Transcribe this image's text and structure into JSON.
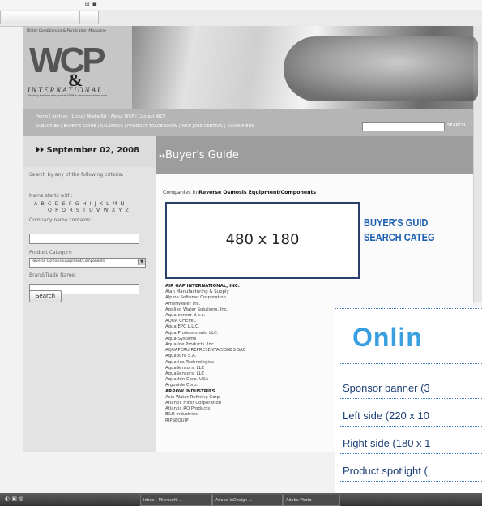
{
  "browser": {
    "top_icons": "⊞ ▣"
  },
  "site": {
    "magazine_tagline": "Water Conditioning & Purification Magazine",
    "logo_letters": "WCP",
    "logo_amp": "&",
    "logo_international": "INTERNATIONAL",
    "logo_serving": "Serving the industry since 1959 • www.wcponline.com",
    "nav_line1": "Home | Archive | Links | Media Kit | About WCP | Contact WCP",
    "nav_line2": "SUBSCRIBE | BUYER'S GUIDE | CALENDAR | PRODUCT TRADE SHOW | WCP JOBS CENTRAL | CLASSIFIEDS",
    "search_button": "SEARCH"
  },
  "sidebar": {
    "date": "September 02, 2008",
    "search_heading": "Search by any of the following criteria:",
    "name_starts_label": "Name starts with:",
    "alphabet_row1": "A B C D E F G H I J K L M N",
    "alphabet_row2": "O P Q R S T U V W X Y Z",
    "company_label": "Company name contains:",
    "category_label": "Product Category:",
    "category_value": "Reverse Osmosis Equipment/Components",
    "brand_label": "Brand/Trade Name:",
    "search_button": "Search"
  },
  "main": {
    "title": "Buyer's Guide",
    "companies_prefix": "Companies in ",
    "companies_category": "Reverse Osmosis Equipment/Components",
    "ad_placeholder": "480 x 180",
    "companies": [
      {
        "name": "AIR GAP INTERNATIONAL, INC.",
        "bold": true
      },
      {
        "name": "Alan Manufacturing & Supply",
        "bold": false
      },
      {
        "name": "Alpine Softener Corporation",
        "bold": false
      },
      {
        "name": "AmeriWater Inc.",
        "bold": false
      },
      {
        "name": "Applied Water Solutions, Inc.",
        "bold": false
      },
      {
        "name": "Aqua center d.o.o.",
        "bold": false
      },
      {
        "name": "AQUA CHEMIC",
        "bold": false
      },
      {
        "name": "Aqua EPC L.L.C.",
        "bold": false
      },
      {
        "name": "Aqua Professionals, LLC.",
        "bold": false
      },
      {
        "name": "Aqua Systems",
        "bold": false
      },
      {
        "name": "Aqualine Products, Inc.",
        "bold": false
      },
      {
        "name": "AQUAPERU REPRESENTACIONES SAC",
        "bold": false
      },
      {
        "name": "Aquapura S.A.",
        "bold": false
      },
      {
        "name": "Aquarius Technologies",
        "bold": false
      },
      {
        "name": "AquaSensors, LLC",
        "bold": false
      },
      {
        "name": "AquaSensors, LLC",
        "bold": false
      },
      {
        "name": "Aquathin Corp. USA",
        "bold": false
      },
      {
        "name": "Argonide Corp.",
        "bold": false
      },
      {
        "name": "ARROW INDUSTRIES",
        "bold": true
      },
      {
        "name": "Asia Water Refining Corp.",
        "bold": false
      },
      {
        "name": "Atlantic Filter Corporation",
        "bold": false
      },
      {
        "name": "Atlantic RO Products",
        "bold": false
      },
      {
        "name": "B&R Industries",
        "bold": false
      },
      {
        "name": "RIPSEQUIP",
        "bold": false
      }
    ]
  },
  "overlay": {
    "heading_line1": "BUYER'S GUID",
    "heading_line2": "SEARCH CATEG",
    "online_title": "Onlin",
    "specs": [
      "Sponsor banner (3",
      "Left side (220 x 10",
      "Right side (180 x 1",
      "Product spotlight ("
    ]
  },
  "taskbar": {
    "start": "◐ ▣ ◍",
    "tasks": [
      "Inbox - Microsoft ...",
      "Adobe InDesign ...",
      "Adobe Photo"
    ]
  },
  "colors": {
    "accent_blue": "#1a5fb0",
    "online_blue": "#3a9fe0",
    "ad_border": "#2a3f6b"
  }
}
